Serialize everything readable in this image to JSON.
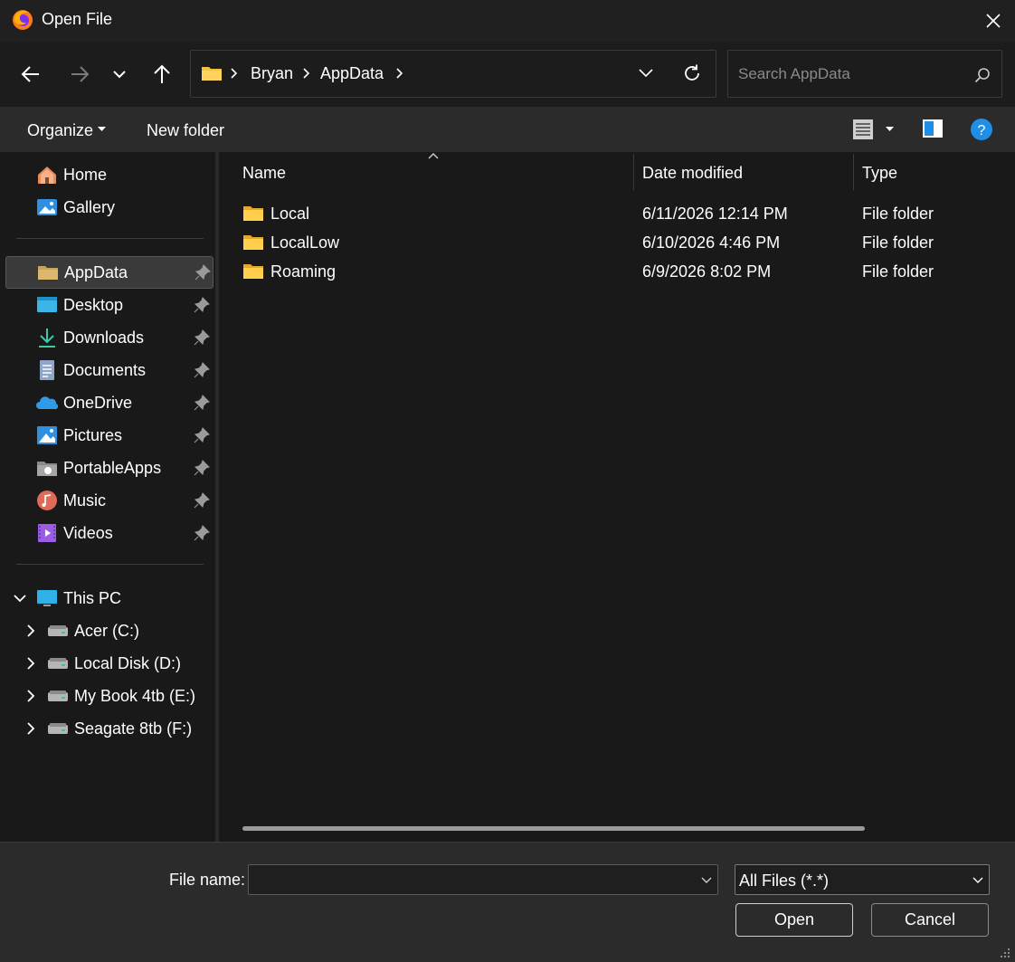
{
  "window": {
    "title": "Open File"
  },
  "nav": {
    "breadcrumb": [
      "Bryan",
      "AppData"
    ],
    "search_placeholder": "Search AppData"
  },
  "commandbar": {
    "organize_label": "Organize",
    "new_folder_label": "New folder"
  },
  "sidebar": {
    "quick": [
      {
        "label": "Home",
        "icon": "home-icon"
      },
      {
        "label": "Gallery",
        "icon": "gallery-icon"
      }
    ],
    "pinned": [
      {
        "label": "AppData",
        "icon": "folder-icon",
        "selected": true
      },
      {
        "label": "Desktop",
        "icon": "desktop-icon"
      },
      {
        "label": "Downloads",
        "icon": "downloads-icon"
      },
      {
        "label": "Documents",
        "icon": "documents-icon"
      },
      {
        "label": "OneDrive",
        "icon": "onedrive-icon"
      },
      {
        "label": "Pictures",
        "icon": "pictures-icon"
      },
      {
        "label": "PortableApps",
        "icon": "portableapps-icon"
      },
      {
        "label": "Music",
        "icon": "music-icon"
      },
      {
        "label": "Videos",
        "icon": "videos-icon"
      }
    ],
    "this_pc": {
      "label": "This PC",
      "expanded": true
    },
    "drives": [
      {
        "label": "Acer (C:)"
      },
      {
        "label": "Local Disk (D:)"
      },
      {
        "label": "My Book 4tb (E:)"
      },
      {
        "label": "Seagate 8tb (F:)"
      }
    ]
  },
  "file_list": {
    "columns": [
      "Name",
      "Date modified",
      "Type"
    ],
    "rows": [
      {
        "name": "Local",
        "date": "6/11/2026 12:14 PM",
        "type": "File folder"
      },
      {
        "name": "LocalLow",
        "date": "6/10/2026 4:46 PM",
        "type": "File folder"
      },
      {
        "name": "Roaming",
        "date": "6/9/2026 8:02 PM",
        "type": "File folder"
      }
    ]
  },
  "footer": {
    "file_name_label": "File name:",
    "file_name_value": "",
    "filter_value": "All Files (*.*)",
    "open_label": "Open",
    "cancel_label": "Cancel"
  },
  "colors": {
    "folder": "#f3c043",
    "accent": "#1e8ee6",
    "background": "#202020"
  }
}
